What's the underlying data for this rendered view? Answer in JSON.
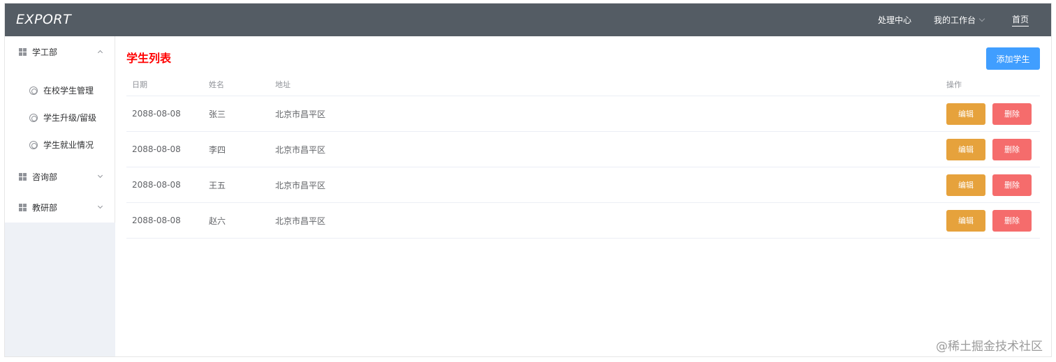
{
  "header": {
    "logo": "EXPORT",
    "nav": [
      {
        "label": "处理中心"
      },
      {
        "label": "我的工作台"
      },
      {
        "label": "首页"
      }
    ]
  },
  "sidebar": {
    "groups": [
      {
        "label": "学工部",
        "icon": "grid-icon",
        "expanded": true,
        "items": [
          {
            "label": "在校学生管理",
            "icon": "circle-icon"
          },
          {
            "label": "学生升级/留级",
            "icon": "circle-icon"
          },
          {
            "label": "学生就业情况",
            "icon": "circle-icon"
          }
        ]
      },
      {
        "label": "咨询部",
        "icon": "grid-icon",
        "expanded": false
      },
      {
        "label": "教研部",
        "icon": "grid-icon",
        "expanded": false
      }
    ]
  },
  "main": {
    "title": "学生列表",
    "add_button": "添加学生",
    "table": {
      "headers": {
        "date": "日期",
        "name": "姓名",
        "address": "地址",
        "ops": "操作"
      },
      "rows": [
        {
          "date": "2088-08-08",
          "name": "张三",
          "address": "北京市昌平区",
          "edit": "编辑",
          "delete": "删除"
        },
        {
          "date": "2088-08-08",
          "name": "李四",
          "address": "北京市昌平区",
          "edit": "编辑",
          "delete": "删除"
        },
        {
          "date": "2088-08-08",
          "name": "王五",
          "address": "北京市昌平区",
          "edit": "编辑",
          "delete": "删除"
        },
        {
          "date": "2088-08-08",
          "name": "赵六",
          "address": "北京市昌平区",
          "edit": "编辑",
          "delete": "删除"
        }
      ]
    }
  },
  "watermark": "@稀土掘金技术社区",
  "colors": {
    "header_bg": "#545c64",
    "title_red": "#ff0000",
    "primary": "#409eff",
    "warning": "#e6a23c",
    "danger": "#f56c6c",
    "sidebar_bg": "#eef1f6"
  }
}
